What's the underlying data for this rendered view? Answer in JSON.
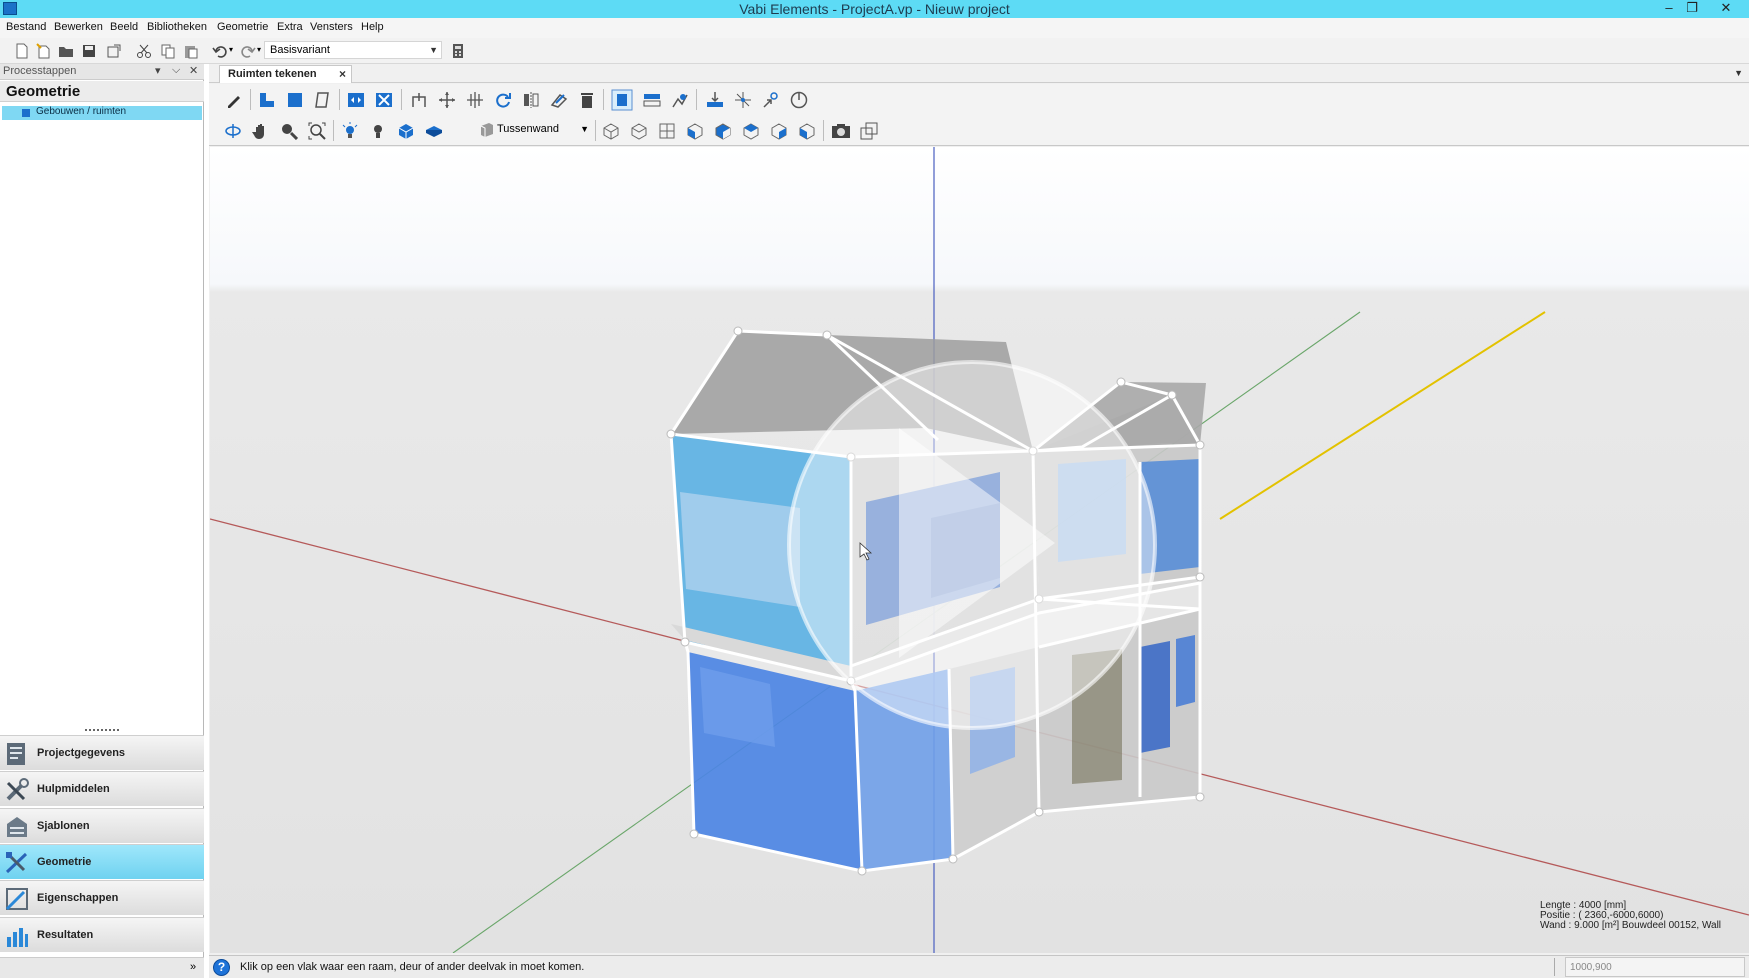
{
  "window": {
    "title": "Vabi Elements - ProjectA.vp - Nieuw project"
  },
  "menu": [
    "Bestand",
    "Bewerken",
    "Beeld",
    "Bibliotheken",
    "Geometrie",
    "Extra",
    "Vensters",
    "Help"
  ],
  "toolbar": {
    "variant_value": "Basisvariant"
  },
  "left_panel": {
    "header": "Processtappen",
    "title": "Geometrie",
    "tree_item": "Gebouwen / ruimten",
    "nav": [
      {
        "label": "Projectgegevens",
        "icon": "project-icon"
      },
      {
        "label": "Hulpmiddelen",
        "icon": "tools-icon"
      },
      {
        "label": "Sjablonen",
        "icon": "templates-icon"
      },
      {
        "label": "Geometrie",
        "icon": "geometry-icon",
        "active": true
      },
      {
        "label": "Eigenschappen",
        "icon": "properties-icon"
      },
      {
        "label": "Resultaten",
        "icon": "results-icon"
      }
    ]
  },
  "doc_tab": {
    "label": "Ruimten tekenen"
  },
  "draw_toolbar": {
    "wall_type": "Tussenwand"
  },
  "viewport_info": {
    "line1": "Lengte :     4000 [mm]",
    "line2": "Positie :  (   2360,-6000,6000)",
    "line3": "Wand :   9.000 [m²] Bouwdeel 00152, Wall"
  },
  "status": {
    "message": "Klik op een vlak waar een raam, deur of ander deelvak in moet komen.",
    "coords": "1000,900"
  },
  "colors": {
    "titlebar": "#5ddbf5",
    "accent": "#7fd8f3",
    "glass": "#2a6fe0"
  }
}
